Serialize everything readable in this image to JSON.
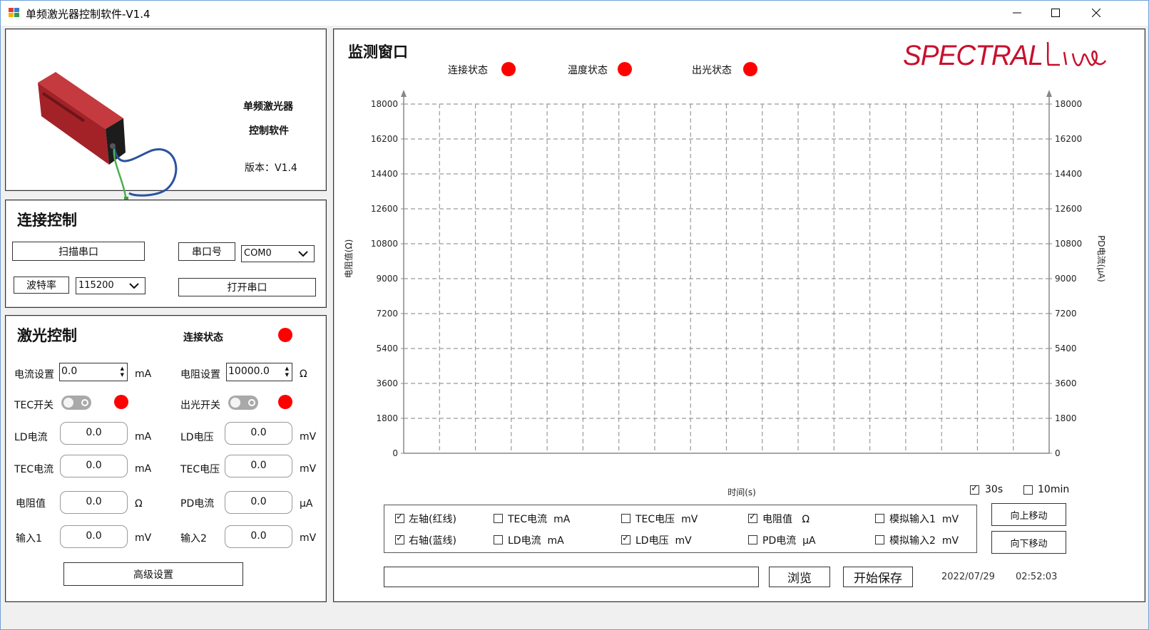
{
  "window": {
    "title": "单频激光器控制软件-V1.4",
    "buttons": [
      "minimize",
      "maximize",
      "close"
    ]
  },
  "info_panel": {
    "line1": "单频激光器",
    "line2": "控制软件",
    "version": "版本：V1.4"
  },
  "connection": {
    "heading": "连接控制",
    "scan_button": "扫描串口",
    "port_label": "串口号",
    "port_value": "COM0",
    "baud_label": "波特率",
    "baud_value": "115200",
    "open_button": "打开串口"
  },
  "laser": {
    "heading": "激光控制",
    "status_label": "连接状态",
    "current_set_label": "电流设置",
    "current_set_value": "0.0",
    "current_set_unit": "mA",
    "resistance_set_label": "电阻设置",
    "resistance_set_value": "10000.0",
    "resistance_set_unit": "Ω",
    "tec_switch_label": "TEC开关",
    "light_switch_label": "出光开关",
    "readouts": [
      {
        "label": "LD电流",
        "value": "0.0",
        "unit": "mA"
      },
      {
        "label": "LD电压",
        "value": "0.0",
        "unit": "mV"
      },
      {
        "label": "TEC电流",
        "value": "0.0",
        "unit": "mA"
      },
      {
        "label": "TEC电压",
        "value": "0.0",
        "unit": "mV"
      },
      {
        "label": "电阻值",
        "value": "0.0",
        "unit": "Ω"
      },
      {
        "label": "PD电流",
        "value": "0.0",
        "unit": "μA"
      },
      {
        "label": "输入1",
        "value": "0.0",
        "unit": "mV"
      },
      {
        "label": "输入2",
        "value": "0.0",
        "unit": "mV"
      }
    ],
    "advanced_button": "高级设置"
  },
  "monitor": {
    "heading": "监测窗口",
    "brand": "SPECTRALine",
    "status": [
      {
        "label": "连接状态"
      },
      {
        "label": "温度状态"
      },
      {
        "label": "出光状态"
      }
    ],
    "checkboxes_time": [
      {
        "label": "30s",
        "checked": true
      },
      {
        "label": "10min",
        "checked": false
      }
    ],
    "series_checkboxes": [
      {
        "label": "左轴(红线)",
        "checked": true
      },
      {
        "label": "TEC电流",
        "unit": "mA",
        "checked": false
      },
      {
        "label": "TEC电压",
        "unit": "mV",
        "checked": false
      },
      {
        "label": "电阻值",
        "unit": "Ω",
        "checked": true
      },
      {
        "label": "模拟输入1",
        "unit": "mV",
        "checked": false
      },
      {
        "label": "右轴(蓝线)",
        "checked": true
      },
      {
        "label": "LD电流",
        "unit": "mA",
        "checked": false
      },
      {
        "label": "LD电压",
        "unit": "mV",
        "checked": true
      },
      {
        "label": "PD电流",
        "unit": "μA",
        "checked": false
      },
      {
        "label": "模拟输入2",
        "unit": "mV",
        "checked": false
      }
    ],
    "move_up_button": "向上移动",
    "move_down_button": "向下移动",
    "path_value": "",
    "browse_button": "浏览",
    "save_button": "开始保存",
    "date": "2022/07/29",
    "time": "02:52:03"
  },
  "colors": {
    "led": "#ff0000",
    "brand": "#c8102e",
    "device": "#b8232a"
  },
  "chart_data": {
    "type": "line",
    "xlabel": "时间(s)",
    "ylabel_left": "电阻值(Ω)",
    "ylabel_right": "PD电流(μA)",
    "ylim": [
      0,
      18000
    ],
    "yticks": [
      0,
      1800,
      3600,
      5400,
      7200,
      9000,
      10800,
      12600,
      14400,
      16200,
      18000
    ],
    "x_gridlines": 18,
    "grid": "dashed",
    "series": []
  }
}
